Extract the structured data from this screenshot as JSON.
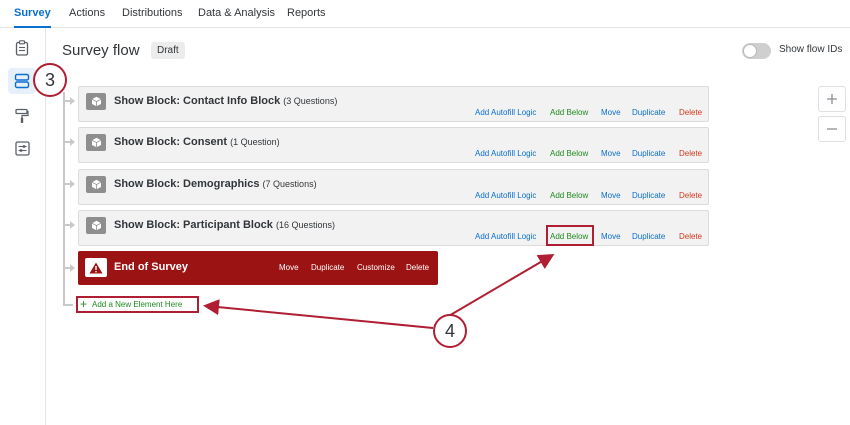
{
  "topnav": {
    "tabs": [
      {
        "label": "Survey"
      },
      {
        "label": "Actions"
      },
      {
        "label": "Distributions"
      },
      {
        "label": "Data & Analysis"
      },
      {
        "label": "Reports"
      }
    ],
    "active": "Survey"
  },
  "sidebar": {
    "items": [
      {
        "icon": "clipboard-icon"
      },
      {
        "icon": "survey-flow-icon",
        "active": true
      },
      {
        "icon": "paint-roller-icon"
      },
      {
        "icon": "sliders-icon"
      }
    ]
  },
  "header": {
    "title": "Survey flow",
    "badge": "Draft",
    "toggle_label": "Show flow IDs",
    "toggle_on": false
  },
  "zoom": {
    "in": "+",
    "out": "−"
  },
  "blocks": [
    {
      "title": "Show Block: Contact Info Block",
      "count": "(3 Questions)"
    },
    {
      "title": "Show Block: Consent",
      "count": "(1 Question)"
    },
    {
      "title": "Show Block: Demographics",
      "count": "(7 Questions)"
    },
    {
      "title": "Show Block: Participant Block",
      "count": "(16 Questions)"
    }
  ],
  "block_actions": {
    "autofill": "Add Autofill Logic",
    "add_below": "Add Below",
    "move": "Move",
    "duplicate": "Duplicate",
    "delete": "Delete"
  },
  "end_of_survey": {
    "title": "End of Survey",
    "actions": {
      "move": "Move",
      "duplicate": "Duplicate",
      "customize": "Customize",
      "delete": "Delete"
    }
  },
  "add_element": "Add a New Element Here",
  "callouts": {
    "step3": "3",
    "step4": "4"
  },
  "colors": {
    "accent": "#0b6ed0",
    "green": "#1f8a1f",
    "red": "#d0391e",
    "end_of_survey": "#9b1313",
    "annotation": "#b01e33"
  }
}
